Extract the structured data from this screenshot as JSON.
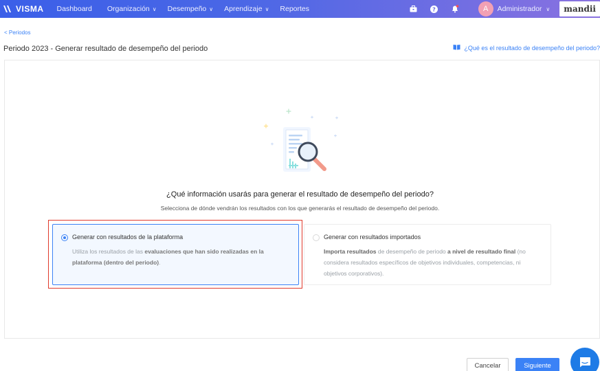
{
  "nav": {
    "brand": "VISMA",
    "items": [
      {
        "label": "Dashboard",
        "has_chevron": false
      },
      {
        "label": "Organización",
        "has_chevron": true
      },
      {
        "label": "Desempeño",
        "has_chevron": true
      },
      {
        "label": "Aprendizaje",
        "has_chevron": true
      },
      {
        "label": "Reportes",
        "has_chevron": false
      }
    ],
    "chevron": "∨",
    "avatar_letter": "A",
    "user_label": "Administrador",
    "logo_text": "mandii"
  },
  "breadcrumb": "< Periodos",
  "page_title": "Periodo 2023 - Generar resultado de desempeño del periodo",
  "help_link": "¿Qué es el resultado de desempeño del periodo?",
  "question": "¿Qué información usarás para generar el resultado de desempeño del periodo?",
  "subtitle": "Selecciona de dónde vendrán los resultados con los que generarás el resultado de desempeño del periodo.",
  "options": [
    {
      "title": "Generar con resultados de la plataforma",
      "desc_pre": "Utiliza los resultados de las ",
      "desc_bold": "evaluaciones que han sido realizadas en la plataforma (dentro del periodo)",
      "desc_post": ".",
      "selected": true
    },
    {
      "title": "Generar con resultados importados",
      "desc_bold1": "Importa resultados",
      "desc_mid": " de desempeño de periodo ",
      "desc_bold2": "a nivel de resultado final",
      "desc_post": " (no considera resultados específicos de objetivos individuales, competencias, ni objetivos corporativos).",
      "selected": false
    }
  ],
  "buttons": {
    "cancel": "Cancelar",
    "next": "Siguiente"
  },
  "colors": {
    "accent": "#3b82f6",
    "highlight": "#e0392b",
    "nav_start": "#3b5fe8",
    "nav_end": "#8a72e0"
  },
  "icons": [
    "briefcase-icon",
    "help-icon",
    "bell-icon",
    "book-icon",
    "chat-icon"
  ]
}
